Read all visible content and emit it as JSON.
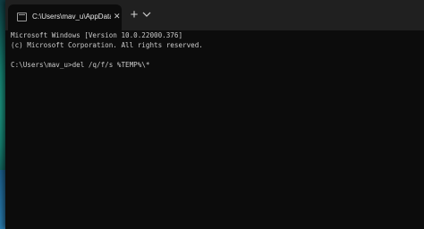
{
  "tab": {
    "title": "C:\\Users\\mav_u\\AppData\\Roam",
    "close_icon": "close-icon",
    "new_tab_icon": "plus-icon",
    "dropdown_icon": "chevron-down-icon"
  },
  "console": {
    "lines": [
      "Microsoft Windows [Version 10.0.22000.376]",
      "(c) Microsoft Corporation. All rights reserved.",
      "C:\\Users\\mav_u>del /q/f/s %TEMP%\\*"
    ]
  },
  "colors": {
    "titlebar": "#202020",
    "console_bg": "#0c0c0c",
    "console_text": "#cccccc"
  }
}
